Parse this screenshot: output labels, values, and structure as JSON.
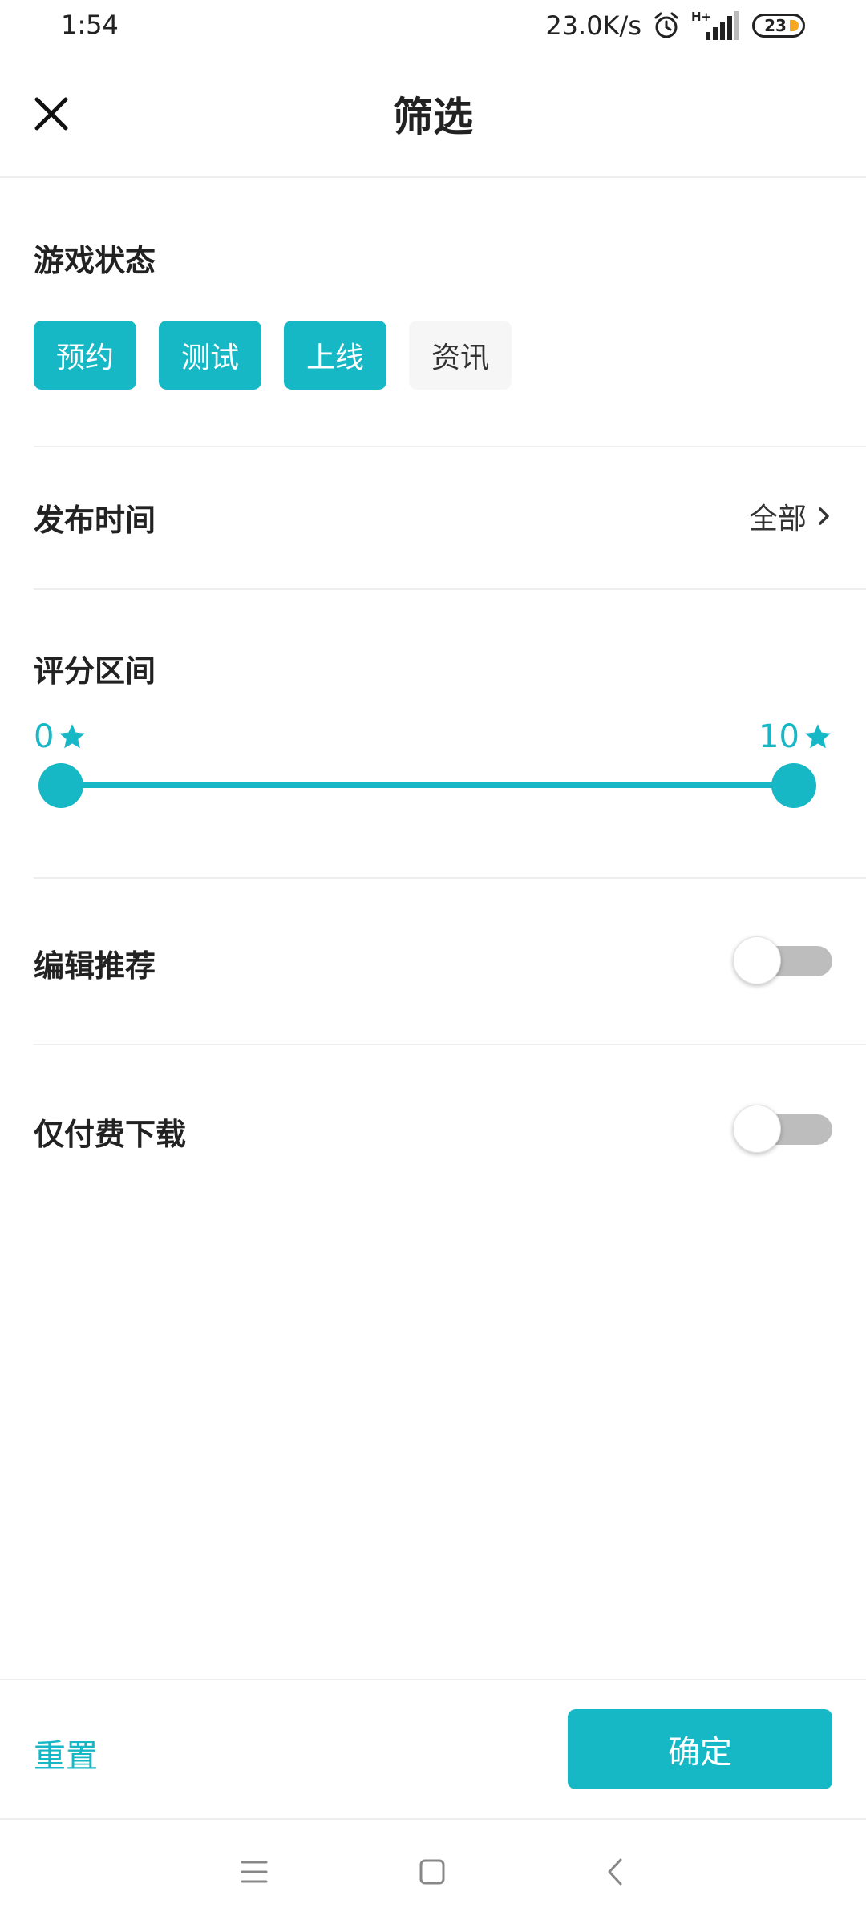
{
  "status_bar": {
    "time": "1:54",
    "network_speed": "23.0K/s",
    "network_type": "H+",
    "battery_level": "23",
    "icons": [
      "alarm-icon",
      "signal-icon",
      "battery-icon"
    ]
  },
  "header": {
    "title": "筛选",
    "close_icon": "close-icon"
  },
  "game_status": {
    "title": "游戏状态",
    "chips": [
      {
        "label": "预约",
        "selected": true
      },
      {
        "label": "测试",
        "selected": true
      },
      {
        "label": "上线",
        "selected": true
      },
      {
        "label": "资讯",
        "selected": false
      }
    ]
  },
  "release_time": {
    "title": "发布时间",
    "value": "全部",
    "icon": "chevron-right-icon"
  },
  "rating_range": {
    "title": "评分区间",
    "min_label": "0",
    "max_label": "10",
    "min_value": 0,
    "max_value": 10,
    "icon": "star-icon"
  },
  "editor_pick": {
    "title": "编辑推荐",
    "enabled": false
  },
  "paid_only": {
    "title": "仅付费下载",
    "enabled": false
  },
  "footer": {
    "reset_label": "重置",
    "confirm_label": "确定"
  },
  "nav_bar": {
    "icons": [
      "menu-icon",
      "home-icon",
      "back-icon"
    ]
  },
  "colors": {
    "accent": "#16b8c6",
    "chip_inactive": "#f6f6f6",
    "toggle_off": "#bdbdbd",
    "divider": "#eeeeee"
  }
}
